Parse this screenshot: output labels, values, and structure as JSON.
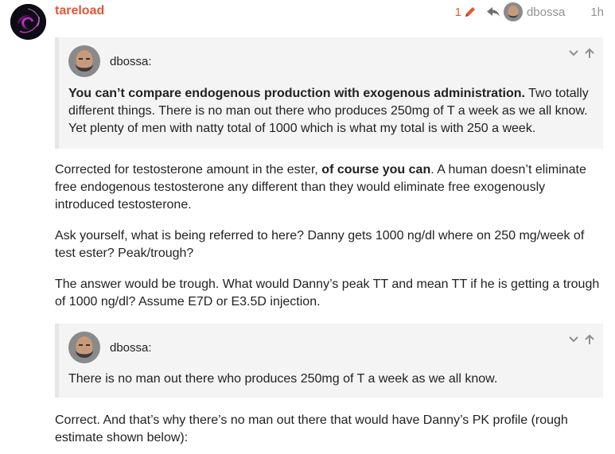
{
  "post": {
    "username": "tareload",
    "edit_count": "1",
    "reply_to_user": "dbossa",
    "date": "1h"
  },
  "quote1": {
    "author": "dbossa:",
    "bold": "You can’t compare endogenous production with exogenous administration.",
    "text": " Two totally different things. There is no man out there who produces 250mg of T a week as we all know. Yet plenty of men with natty total of 1000 which is what my total is with 250 a week."
  },
  "p1": {
    "before": "Corrected for testosterone amount in the ester, ",
    "bold": "of course you can",
    "after": ". A human doesn’t eliminate free endogenous testosterone any different than they would eliminate free exogenously introduced testosterone."
  },
  "p2": "Ask yourself, what is being referred to here? Danny gets 1000 ng/dl where on 250 mg/week of test ester? Peak/trough?",
  "p3": "The answer would be trough. What would Danny’s peak TT and mean TT if he is getting a trough of 1000 ng/dl? Assume E7D or E3.5D injection.",
  "quote2": {
    "author": "dbossa:",
    "text": "There is no man out there who produces 250mg of T a week as we all know."
  },
  "p4": "Correct. And that’s why there’s no man out there that would have Danny’s PK profile (rough estimate shown below):",
  "icons": {
    "edit": "pencil-icon",
    "reply": "share-arrow-icon",
    "expand": "chevron-down-icon",
    "collapse": "arrow-up-icon"
  },
  "colors": {
    "accent": "#e45735",
    "muted": "#919191",
    "quote_bg": "#f4f4f4",
    "quote_border": "#e6e6e6"
  }
}
